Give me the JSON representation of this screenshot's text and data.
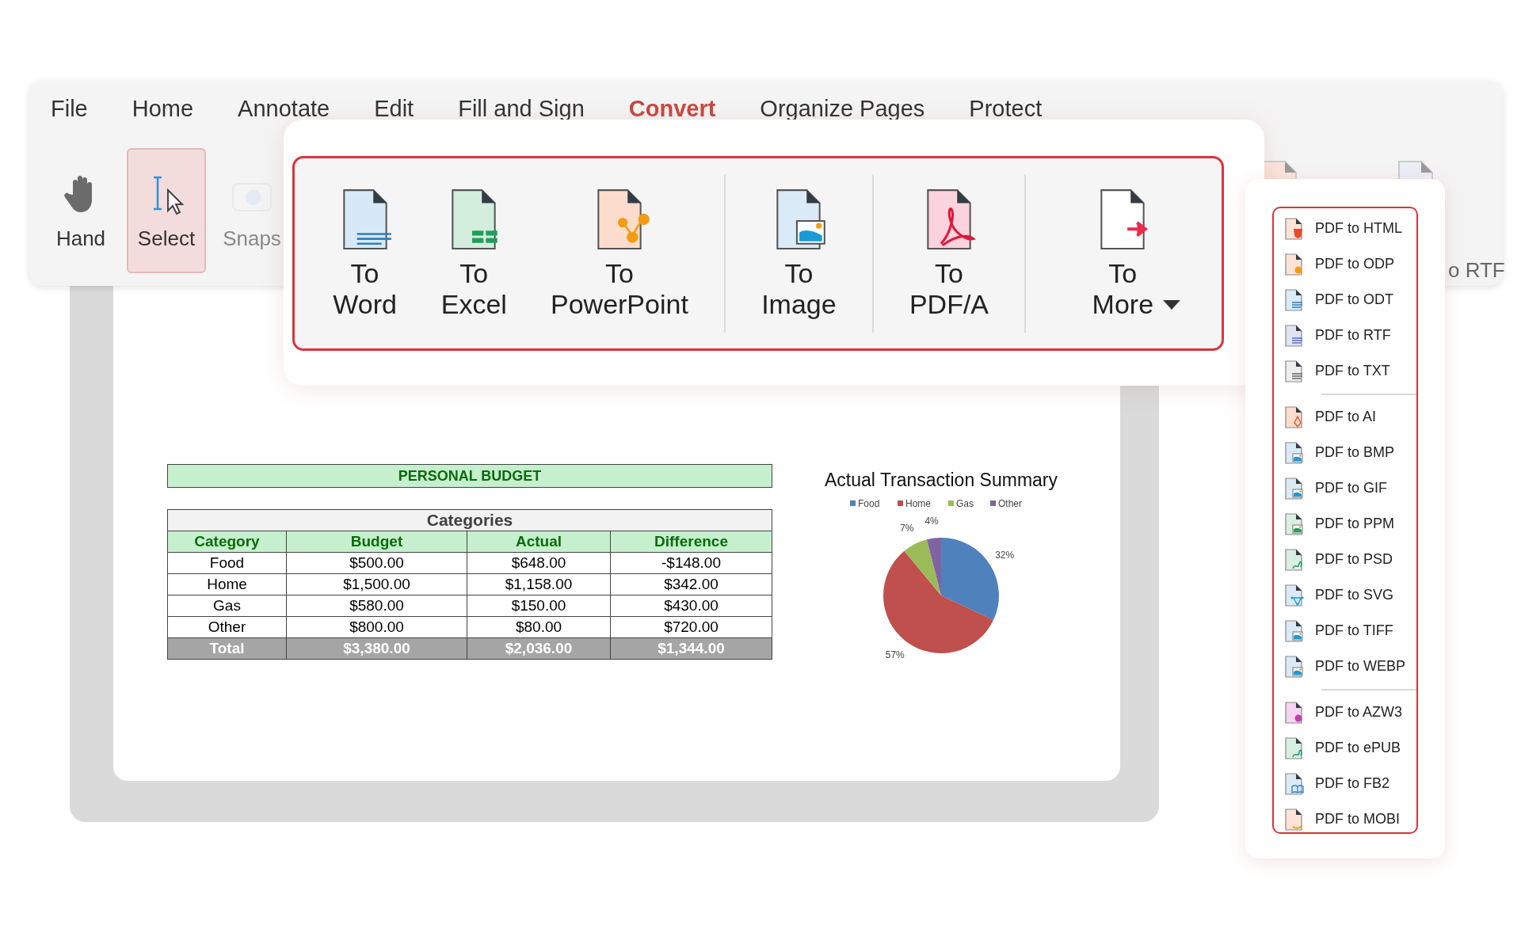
{
  "tabs": [
    {
      "label": "File",
      "selected": false
    },
    {
      "label": "Home",
      "selected": false
    },
    {
      "label": "Annotate",
      "selected": false
    },
    {
      "label": "Edit",
      "selected": false
    },
    {
      "label": "Fill and Sign",
      "selected": false
    },
    {
      "label": "Convert",
      "selected": true
    },
    {
      "label": "Organize Pages",
      "selected": false
    },
    {
      "label": "Protect",
      "selected": false
    }
  ],
  "tools": [
    {
      "label": "Hand",
      "kind": "hand",
      "selected": false
    },
    {
      "label": "Select",
      "kind": "select",
      "selected": true
    },
    {
      "label": "Snaps",
      "kind": "camera",
      "selected": false
    }
  ],
  "hidden_tools": [
    {
      "kind": "html"
    },
    {
      "label": "o RTF",
      "kind": "rtf"
    }
  ],
  "convert": {
    "groups": [
      [
        {
          "label": "To Word",
          "kind": "word",
          "dropdown": false
        },
        {
          "label": "To Excel",
          "kind": "excel",
          "dropdown": false
        },
        {
          "label": "To PowerPoint",
          "kind": "ppt",
          "dropdown": false
        }
      ],
      [
        {
          "label": "To Image",
          "kind": "image",
          "dropdown": false
        }
      ],
      [
        {
          "label": "To PDF/A",
          "kind": "pdfa",
          "dropdown": false
        }
      ],
      [
        {
          "label": "To More",
          "kind": "more",
          "dropdown": true
        }
      ]
    ]
  },
  "more_menu": {
    "groups": [
      [
        {
          "label": "PDF to HTML",
          "kind": "html"
        },
        {
          "label": "PDF to ODP",
          "kind": "odp"
        },
        {
          "label": "PDF to ODT",
          "kind": "odt"
        },
        {
          "label": "PDF to RTF",
          "kind": "rtf"
        },
        {
          "label": "PDF to TXT",
          "kind": "txt"
        }
      ],
      [
        {
          "label": "PDF to AI",
          "kind": "ai"
        },
        {
          "label": "PDF to BMP",
          "kind": "bmp"
        },
        {
          "label": "PDF to GIF",
          "kind": "gif"
        },
        {
          "label": "PDF to PPM",
          "kind": "ppm"
        },
        {
          "label": "PDF to PSD",
          "kind": "psd"
        },
        {
          "label": "PDF to SVG",
          "kind": "svg"
        },
        {
          "label": "PDF to TIFF",
          "kind": "tiff"
        },
        {
          "label": "PDF to WEBP",
          "kind": "webp"
        }
      ],
      [
        {
          "label": "PDF to AZW3",
          "kind": "azw3"
        },
        {
          "label": "PDF to ePUB",
          "kind": "epub"
        },
        {
          "label": "PDF to FB2",
          "kind": "fb2"
        },
        {
          "label": "PDF to MOBI",
          "kind": "mobi"
        }
      ]
    ]
  },
  "budget": {
    "title": "PERSONAL BUDGET",
    "caption": "Categories",
    "columns": [
      "Category",
      "Budget",
      "Actual",
      "Difference"
    ],
    "rows": [
      [
        "Food",
        "$500.00",
        "$648.00",
        "-$148.00"
      ],
      [
        "Home",
        "$1,500.00",
        "$1,158.00",
        "$342.00"
      ],
      [
        "Gas",
        "$580.00",
        "$150.00",
        "$430.00"
      ],
      [
        "Other",
        "$800.00",
        "$80.00",
        "$720.00"
      ]
    ],
    "total": [
      "Total",
      "$3,380.00",
      "$2,036.00",
      "$1,344.00"
    ]
  },
  "chart": {
    "chart_data": {
      "type": "pie",
      "title": "Actual Transaction Summary",
      "categories": [
        "Food",
        "Home",
        "Gas",
        "Other"
      ],
      "values": [
        32,
        57,
        7,
        4
      ],
      "colors": [
        "#4f81bd",
        "#c0504d",
        "#9bbb59",
        "#8064a2"
      ],
      "legend": "top",
      "value_labels": [
        "32%",
        "57%",
        "7%",
        "4%"
      ]
    }
  }
}
